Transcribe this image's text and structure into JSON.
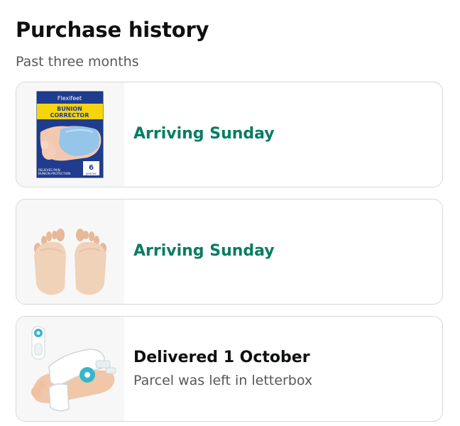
{
  "page": {
    "title": "Purchase history",
    "subtitle": "Past three months"
  },
  "orders": [
    {
      "status": "Arriving Sunday",
      "status_color": "#067d62",
      "image": "bunion-corrector-box",
      "box": {
        "brand": "Flexifeet",
        "product_line1": "BUNION",
        "product_line2": "CORRECTOR",
        "count": "6",
        "count_unit": "pieces",
        "tagline1": "RELIEVES PAIN",
        "tagline2": "BUNION PROTECTION"
      }
    },
    {
      "status": "Arriving Sunday",
      "status_color": "#067d62",
      "image": "gel-bunion-sleeves-on-feet"
    },
    {
      "status": "Delivered 1 October",
      "status_color": "#0f1111",
      "note": "Parcel was left in letterbox",
      "image": "bunion-splint-with-dial"
    }
  ],
  "colors": {
    "delivered_green": "#067d62",
    "secondary_text": "#565959",
    "card_border": "#d5d9d9",
    "box_navy": "#1f3c8f",
    "box_yellow": "#f6d40e"
  }
}
